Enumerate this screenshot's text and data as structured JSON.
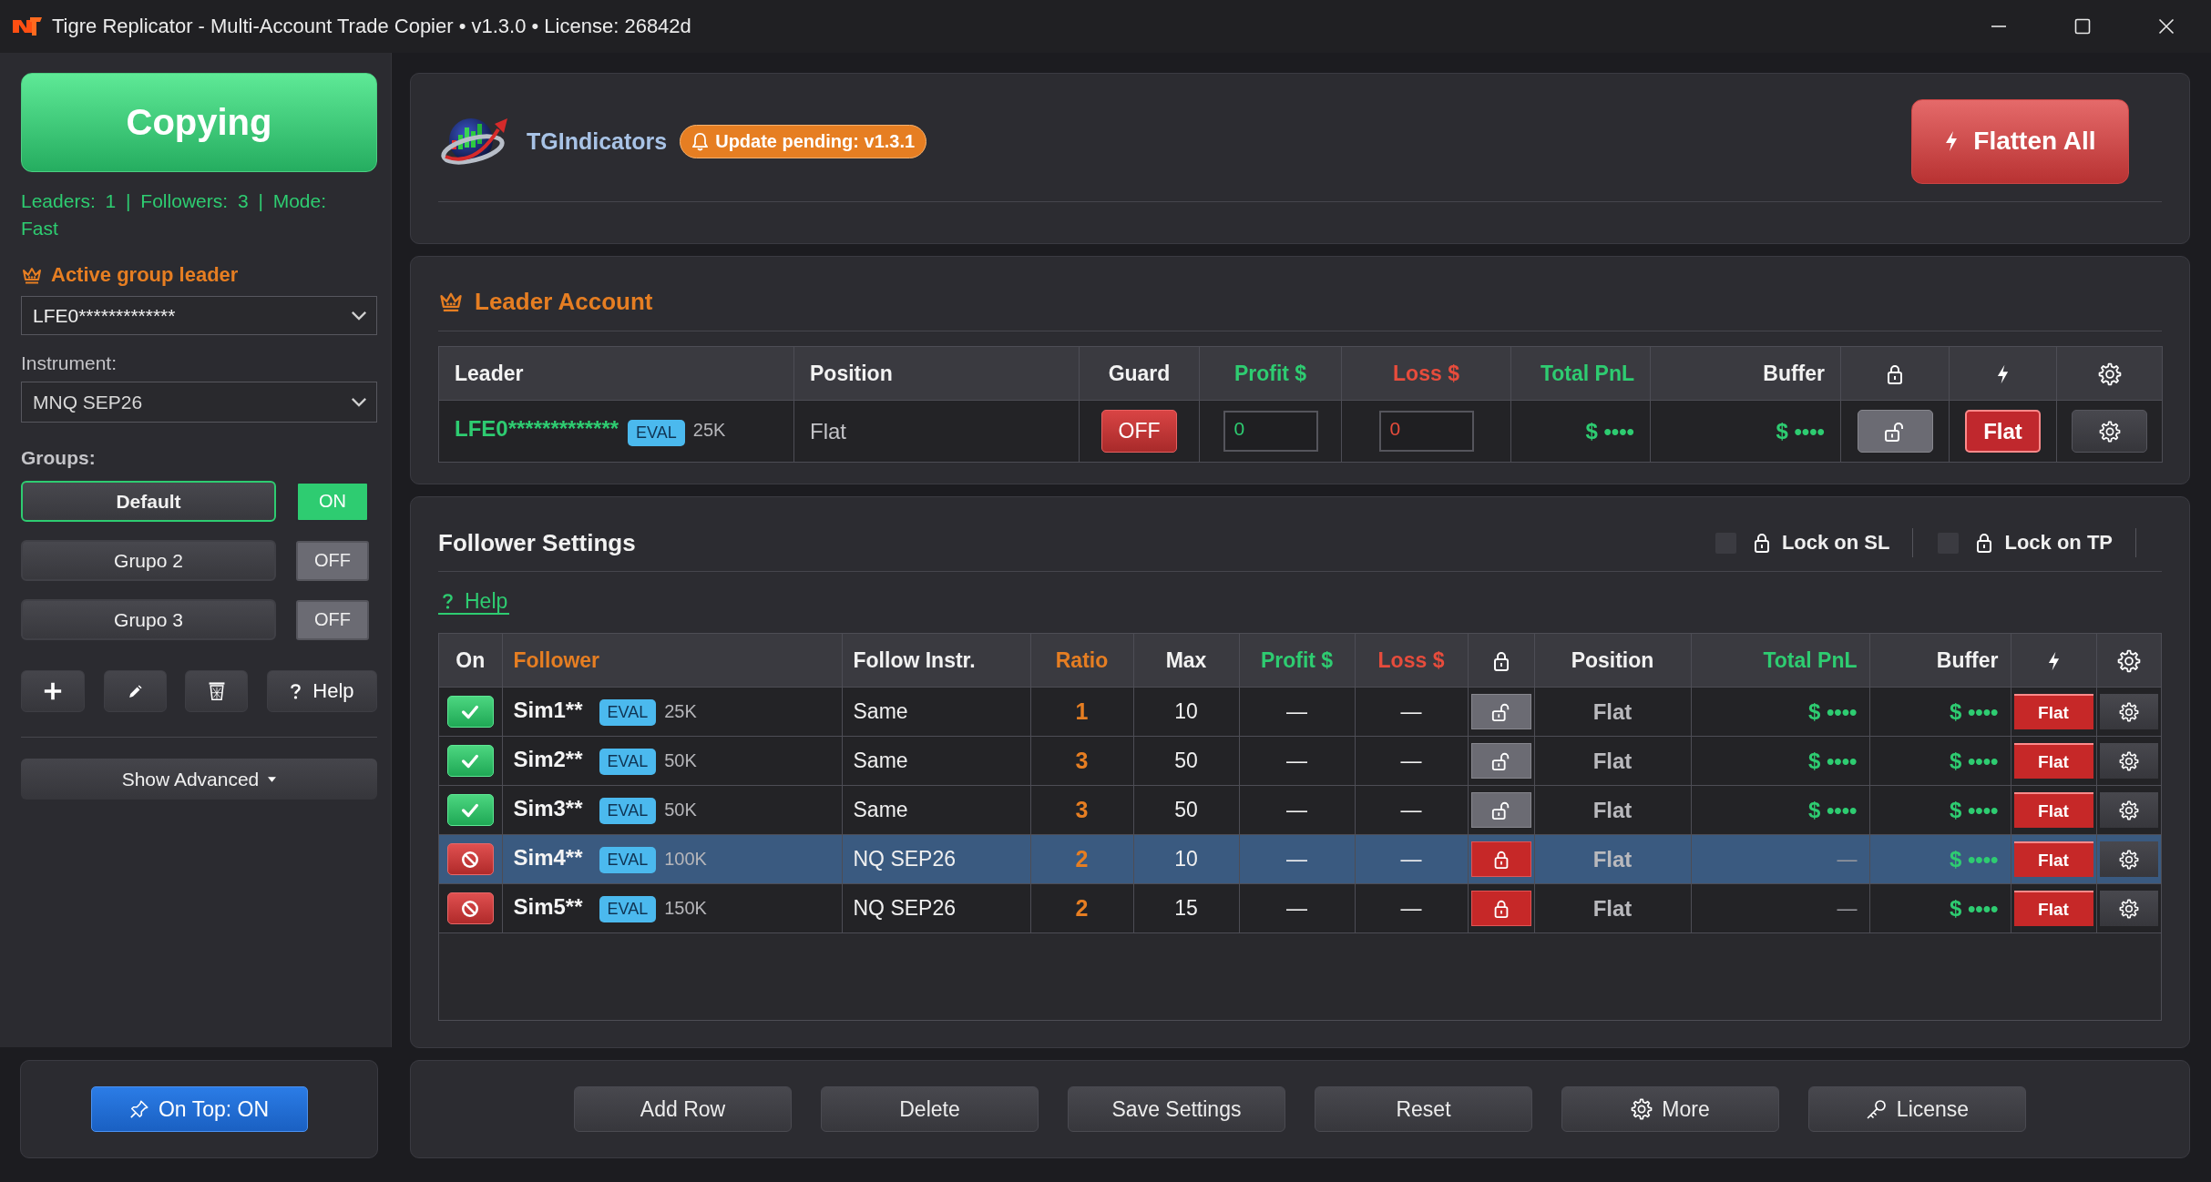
{
  "window": {
    "title": "Tigre Replicator - Multi-Account Trade Copier • v1.3.0 • License: 26842d"
  },
  "sidebar": {
    "copy_button": {
      "label": "Copying",
      "on": true
    },
    "status": "Leaders: 1 | Followers: 3 | Mode: Fast",
    "leader_label": "Active group leader",
    "leader_select": "LFE0*************",
    "instrument_label": "Instrument:",
    "instrument_select": "MNQ SEP26",
    "groups_label": "Groups:",
    "groups": [
      {
        "name": "Default",
        "selected": true,
        "on": true,
        "toggle_label": "ON"
      },
      {
        "name": "Grupo 2",
        "selected": false,
        "on": false,
        "toggle_label": "OFF"
      },
      {
        "name": "Grupo 3",
        "selected": false,
        "on": false,
        "toggle_label": "OFF"
      }
    ],
    "help_button": "Help",
    "advanced_button": "Show Advanced",
    "on_top_button": "On Top: ON"
  },
  "header": {
    "brand": "TGIndicators",
    "update_badge": "Update pending: v1.3.1",
    "flatten_all_button": "Flatten All"
  },
  "leader_account": {
    "title": "Leader Account",
    "columns": [
      {
        "label": "Leader"
      },
      {
        "label": "Position"
      },
      {
        "label": "Guard"
      },
      {
        "label": "Profit $",
        "color": "#2ecc71"
      },
      {
        "label": "Loss $",
        "color": "#e74c3c"
      },
      {
        "label": "Total PnL",
        "color": "#2ecc71"
      },
      {
        "label": "Buffer"
      }
    ],
    "row": {
      "account": "LFE0*************",
      "badge": "EVAL",
      "size": "25K",
      "position": "Flat",
      "guard": {
        "label": "OFF",
        "on": false
      },
      "profit": "0",
      "loss": "0",
      "total_pnl": "$ ••••",
      "buffer": "$ ••••",
      "locked": false,
      "flat_button": "Flat"
    }
  },
  "follower_settings": {
    "title": "Follower Settings",
    "lock_on_sl": {
      "label": "Lock on SL",
      "checked": false
    },
    "lock_on_tp": {
      "label": "Lock on TP",
      "checked": false
    },
    "help_link": "Help",
    "columns": [
      {
        "label": "On"
      },
      {
        "label": "Follower",
        "color": "#e67e22"
      },
      {
        "label": "Follow Instr."
      },
      {
        "label": "Ratio",
        "color": "#e67e22"
      },
      {
        "label": "Max"
      },
      {
        "label": "Profit $",
        "color": "#2ecc71"
      },
      {
        "label": "Loss $",
        "color": "#e74c3c"
      },
      {
        "label": "Position"
      },
      {
        "label": "Total PnL",
        "color": "#2ecc71"
      },
      {
        "label": "Buffer"
      }
    ],
    "rows": [
      {
        "on": true,
        "selected": false,
        "name": "Sim1**",
        "badge": "EVAL",
        "size": "25K",
        "follow_instr": "Same",
        "ratio": "1",
        "max": "10",
        "profit": "—",
        "loss": "—",
        "locked": false,
        "position": "Flat",
        "total_pnl": {
          "text": "$ ••••",
          "kind": "masked"
        },
        "buffer": "$ ••••",
        "flat_button": "Flat"
      },
      {
        "on": true,
        "selected": false,
        "name": "Sim2**",
        "badge": "EVAL",
        "size": "50K",
        "follow_instr": "Same",
        "ratio": "3",
        "max": "50",
        "profit": "—",
        "loss": "—",
        "locked": false,
        "position": "Flat",
        "total_pnl": {
          "text": "$ ••••",
          "kind": "masked"
        },
        "buffer": "$ ••••",
        "flat_button": "Flat"
      },
      {
        "on": true,
        "selected": false,
        "name": "Sim3**",
        "badge": "EVAL",
        "size": "50K",
        "follow_instr": "Same",
        "ratio": "3",
        "max": "50",
        "profit": "—",
        "loss": "—",
        "locked": false,
        "position": "Flat",
        "total_pnl": {
          "text": "$ ••••",
          "kind": "masked"
        },
        "buffer": "$ ••••",
        "flat_button": "Flat"
      },
      {
        "on": false,
        "selected": true,
        "name": "Sim4**",
        "badge": "EVAL",
        "size": "100K",
        "follow_instr": "NQ SEP26",
        "ratio": "2",
        "max": "10",
        "profit": "—",
        "loss": "—",
        "locked": true,
        "position": "Flat",
        "total_pnl": {
          "text": "—",
          "kind": "empty"
        },
        "buffer": "$ ••••",
        "flat_button": "Flat"
      },
      {
        "on": false,
        "selected": false,
        "name": "Sim5**",
        "badge": "EVAL",
        "size": "150K",
        "follow_instr": "NQ SEP26",
        "ratio": "2",
        "max": "15",
        "profit": "—",
        "loss": "—",
        "locked": true,
        "position": "Flat",
        "total_pnl": {
          "text": "—",
          "kind": "empty"
        },
        "buffer": "$ ••••",
        "flat_button": "Flat"
      }
    ]
  },
  "actions": [
    {
      "label": "Add Row",
      "kind": "plain"
    },
    {
      "label": "Delete",
      "kind": "plain"
    },
    {
      "label": "Save Settings",
      "kind": "plain"
    },
    {
      "label": "Reset",
      "kind": "plain"
    },
    {
      "label": "More",
      "kind": "gear"
    },
    {
      "label": "License",
      "kind": "key"
    }
  ]
}
